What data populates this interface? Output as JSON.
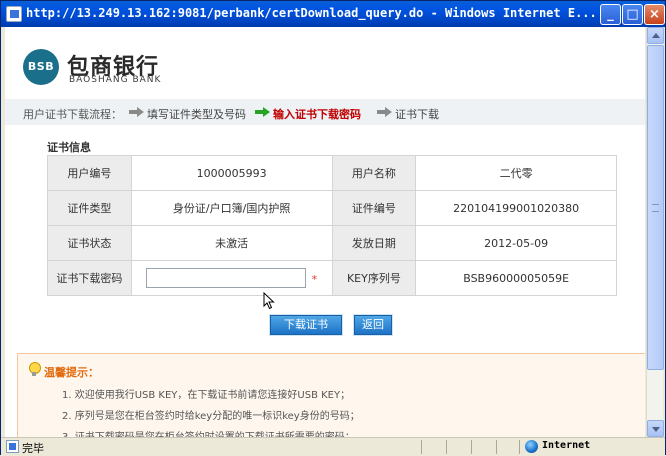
{
  "window": {
    "title": "http://13.249.13.162:9081/perbank/certDownload_query.do - Windows Internet E...",
    "min_label": "_",
    "max_label": "□",
    "close_label": "×"
  },
  "logo": {
    "mark": "BSB",
    "name_cn": "包商银行",
    "name_en": "BAOSHANG BANK"
  },
  "process": {
    "label": "用户证书下载流程：",
    "steps": [
      {
        "label": "填写证件类型及号码",
        "state": "done"
      },
      {
        "label": "输入证书下载密码",
        "state": "current"
      },
      {
        "label": "证书下载",
        "state": "pending"
      }
    ]
  },
  "cert_info": {
    "section_title": "证书信息",
    "rows": [
      [
        {
          "label": "用户编号",
          "value": "1000005993"
        },
        {
          "label": "用户名称",
          "value": "二代零"
        }
      ],
      [
        {
          "label": "证件类型",
          "value": "身份证/户口簿/国内护照"
        },
        {
          "label": "证件编号",
          "value": "220104199001020380"
        }
      ],
      [
        {
          "label": "证书状态",
          "value": "未激活"
        },
        {
          "label": "发放日期",
          "value": "2012-05-09"
        }
      ],
      [
        {
          "label": "证书下载密码",
          "value": "",
          "required_mark": "*"
        },
        {
          "label": "KEY序列号",
          "value": "BSB96000005059E"
        }
      ]
    ]
  },
  "buttons": {
    "download": "下载证书",
    "back": "返回"
  },
  "tips": {
    "title": "温馨提示：",
    "lines": [
      "1. 欢迎使用我行USB KEY，在下载证书前请您连接好USB KEY；",
      "2. 序列号是您在柜台签约时给key分配的唯一标识key身份的号码；",
      "3. 证书下载密码是您在柜台签约时设置的下载证书所需要的密码；"
    ]
  },
  "statusbar": {
    "text": "完毕",
    "zone": "Internet"
  },
  "colors": {
    "title_bar": "#0054e3",
    "current_step": "#c00000",
    "button": "#1d72c6",
    "tips_title": "#e26b10",
    "logo": "#1a6f8a"
  }
}
